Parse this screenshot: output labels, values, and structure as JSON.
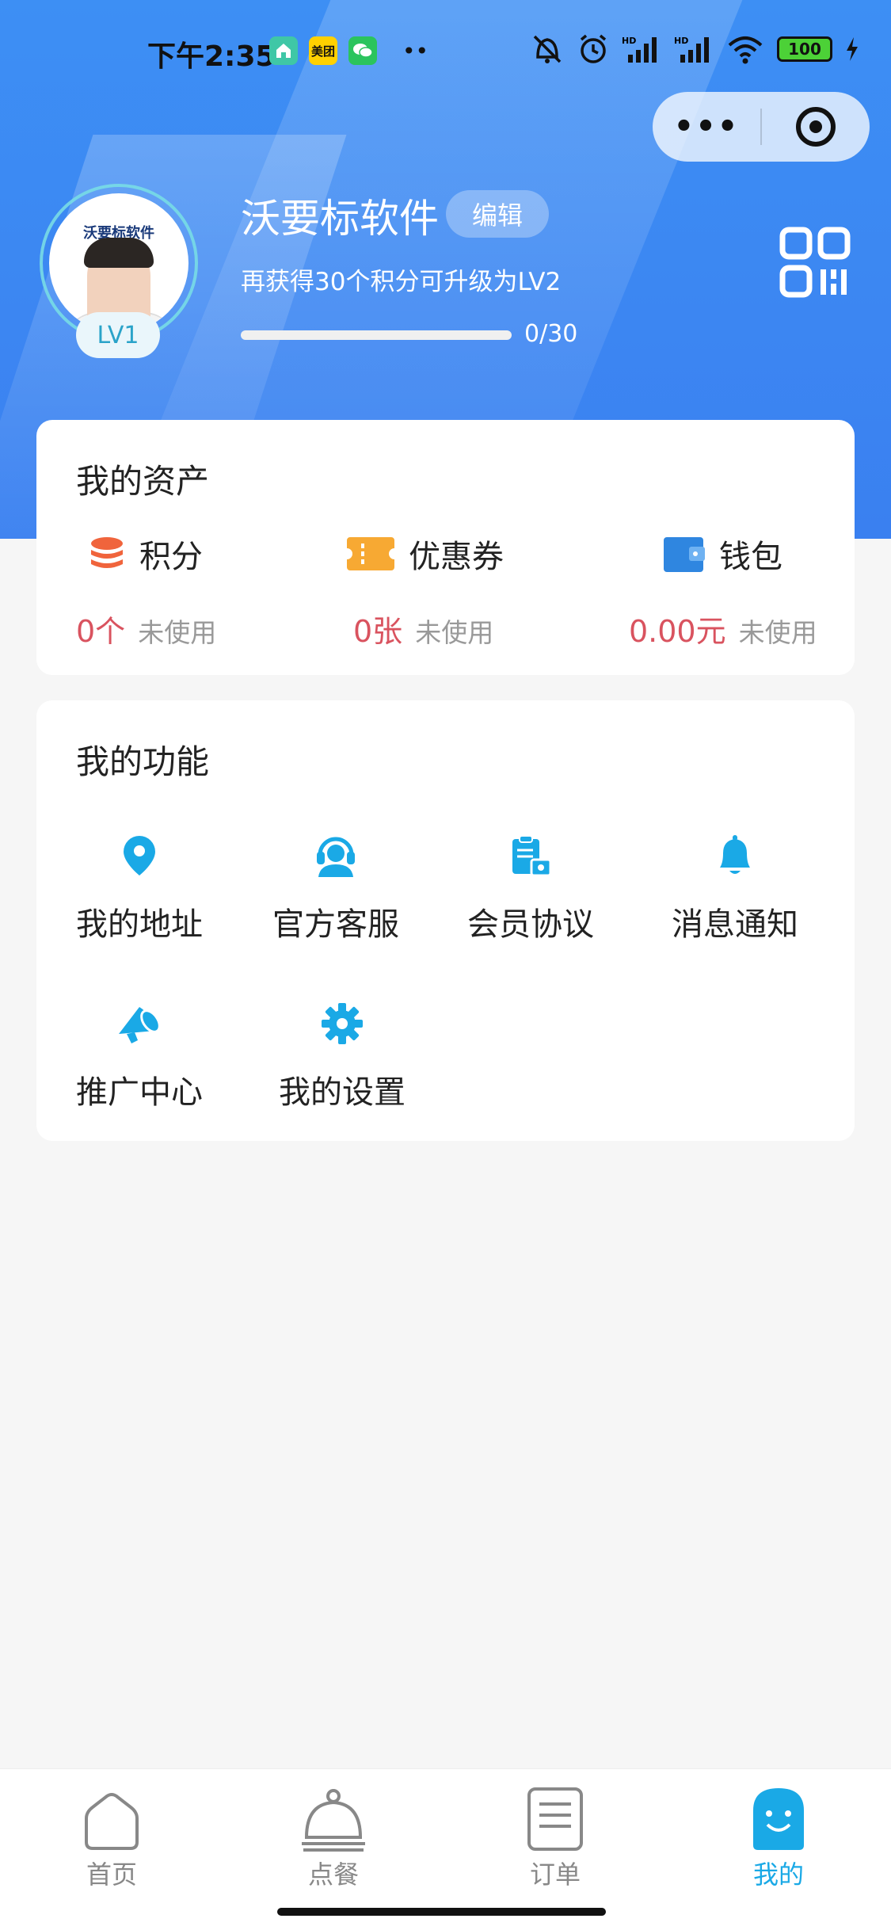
{
  "status_bar": {
    "time": "下午2:35",
    "apps": [
      "美团"
    ],
    "battery": "100"
  },
  "capsule": {
    "more": "•••"
  },
  "profile": {
    "avatar_logo_text": "沃要标软件",
    "level_badge": "LV1",
    "name": "沃要标软件",
    "edit_label": "编辑",
    "upgrade_hint": "再获得30个积分可升级为LV2",
    "progress_value": 0,
    "progress_max": 30,
    "progress_text": "0/30"
  },
  "assets": {
    "title": "我的资产",
    "items": [
      {
        "label": "积分",
        "value": "0个",
        "note": "未使用",
        "icon": "coins-icon",
        "color": "#f0643c"
      },
      {
        "label": "优惠券",
        "value": "0张",
        "note": "未使用",
        "icon": "ticket-icon",
        "color": "#f7a933"
      },
      {
        "label": "钱包",
        "value": "0.00元",
        "note": "未使用",
        "icon": "wallet-icon",
        "color": "#2f86e0"
      }
    ]
  },
  "functions": {
    "title": "我的功能",
    "items": [
      {
        "label": "我的地址",
        "icon": "location-pin-icon"
      },
      {
        "label": "官方客服",
        "icon": "customer-service-icon"
      },
      {
        "label": "会员协议",
        "icon": "clipboard-icon"
      },
      {
        "label": "消息通知",
        "icon": "bell-icon"
      },
      {
        "label": "推广中心",
        "icon": "megaphone-icon"
      },
      {
        "label": "我的设置",
        "icon": "gear-icon"
      }
    ],
    "icon_color": "#1aa9e6"
  },
  "tabbar": {
    "tabs": [
      {
        "label": "首页",
        "icon": "home-icon",
        "active": false
      },
      {
        "label": "点餐",
        "icon": "cloche-icon",
        "active": false
      },
      {
        "label": "订单",
        "icon": "order-list-icon",
        "active": false
      },
      {
        "label": "我的",
        "icon": "smile-face-icon",
        "active": true
      }
    ]
  }
}
